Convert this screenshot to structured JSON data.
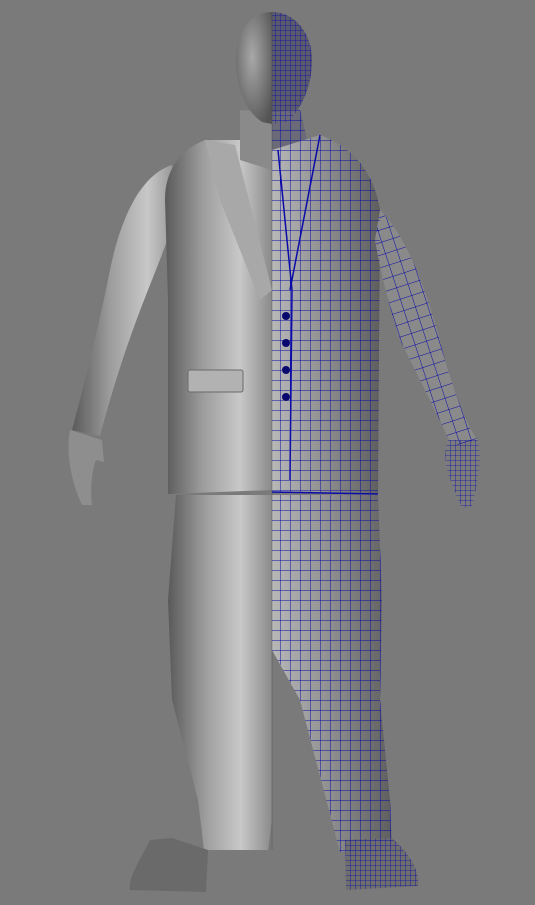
{
  "viewport": {
    "background": "#7a7a7a",
    "left_half": {
      "style": "smooth-shaded-clay",
      "color": "#9a9a9a"
    },
    "right_half": {
      "style": "wireframe-overlay",
      "wire_color": "#0a0a9e"
    }
  },
  "model": {
    "subject": "male-figure-in-suit",
    "parts": [
      "head",
      "turtleneck",
      "jacket",
      "jacket-buttons",
      "pocket-flap",
      "left-arm",
      "right-arm",
      "left-hand",
      "right-hand",
      "trousers",
      "left-shoe",
      "right-shoe"
    ],
    "button_count": 4
  }
}
